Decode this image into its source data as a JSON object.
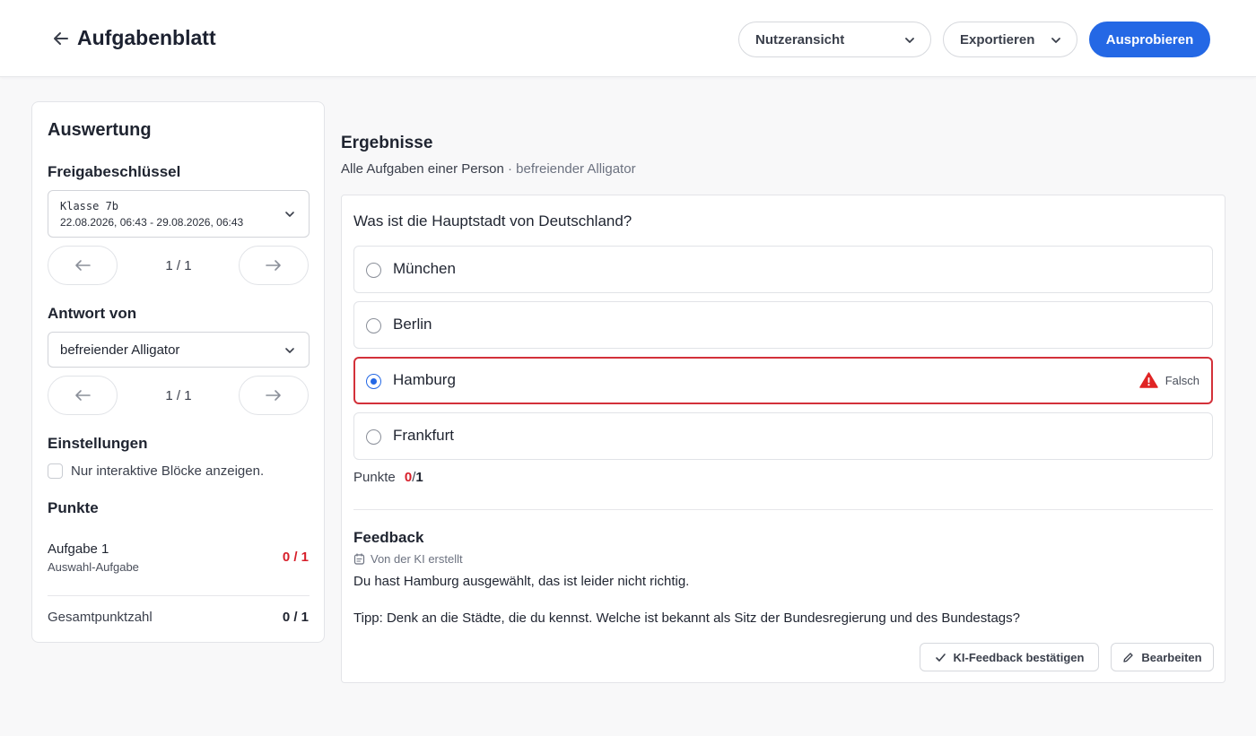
{
  "header": {
    "title": "Aufgabenblatt",
    "view_select": "Nutzeransicht",
    "export_label": "Exportieren",
    "try_label": "Ausprobieren"
  },
  "sidebar": {
    "title": "Auswertung",
    "key_section": "Freigabeschlüssel",
    "key_name": "Klasse 7b",
    "key_range": "22.08.2026, 06:43 - 29.08.2026, 06:43",
    "key_pager": "1 / 1",
    "answer_section": "Antwort von",
    "answer_value": "befreiender Alligator",
    "answer_pager": "1 / 1",
    "settings_section": "Einstellungen",
    "settings_checkbox": "Nur interaktive Blöcke anzeigen.",
    "points_section": "Punkte",
    "task": {
      "name": "Aufgabe 1",
      "type": "Auswahl-Aufgabe",
      "score": "0 / 1"
    },
    "total_label": "Gesamtpunktzahl",
    "total_score": "0 / 1"
  },
  "results": {
    "title": "Ergebnisse",
    "subtitle_main": "Alle Aufgaben einer Person",
    "subtitle_sep": " · ",
    "subtitle_person": "befreiender Alligator",
    "question": "Was ist die Hauptstadt von Deutschland?",
    "options": [
      {
        "label": "München",
        "selected": false
      },
      {
        "label": "Berlin",
        "selected": false
      },
      {
        "label": "Hamburg",
        "selected": true,
        "status": "Falsch"
      },
      {
        "label": "Frankfurt",
        "selected": false
      }
    ],
    "points_label": "Punkte",
    "points_got": "0",
    "points_sep": "/",
    "points_max": "1",
    "feedback_title": "Feedback",
    "feedback_source": "Von der KI erstellt",
    "feedback_line1": "Du hast Hamburg ausgewählt, das ist leider nicht richtig.",
    "feedback_line2": "Tipp: Denk an die Städte, die du kennst. Welche ist bekannt als Sitz der Bundesregierung und des Bundestags?",
    "confirm_label": "KI-Feedback bestätigen",
    "edit_label": "Bearbeiten"
  },
  "colors": {
    "accent": "#2468e5",
    "error": "#d71f2a",
    "warning_icon": "#e02424"
  },
  "icons": [
    "arrow-left-icon",
    "chevron-down-icon",
    "arrow-right-icon",
    "warning-icon",
    "sparkle-note-icon",
    "check-icon",
    "pencil-icon"
  ]
}
